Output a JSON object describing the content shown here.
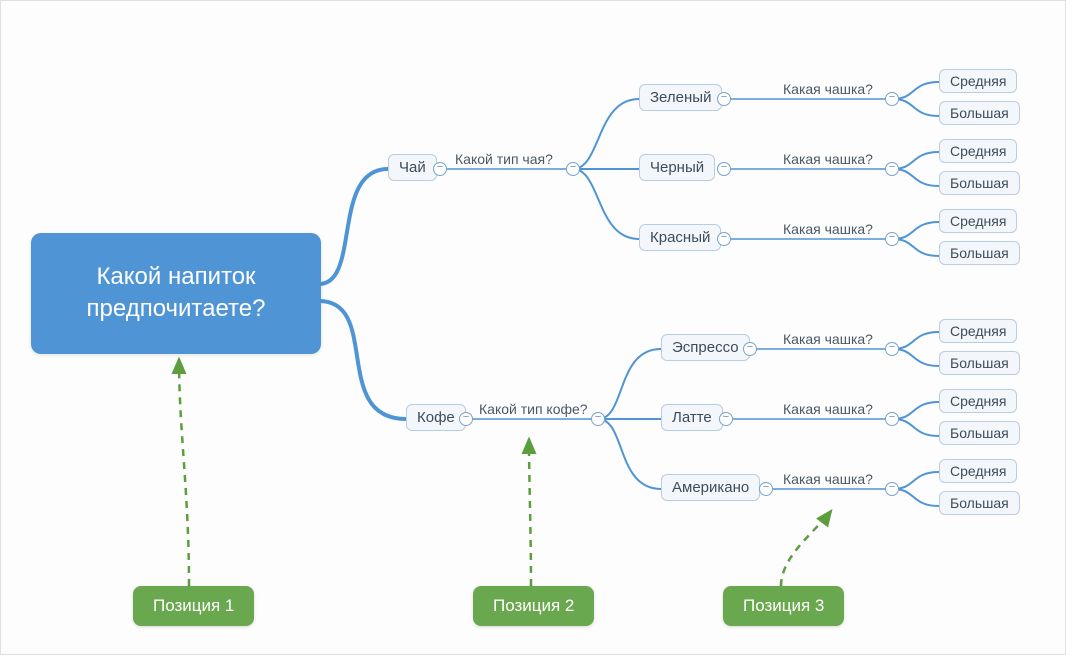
{
  "root": {
    "label": "Какой напиток предпочитаете?"
  },
  "level1": {
    "tea": {
      "label": "Чай",
      "question": "Какой тип чая?"
    },
    "coffee": {
      "label": "Кофе",
      "question": "Какой тип кофе?"
    }
  },
  "level2": {
    "green": {
      "label": "Зеленый",
      "question": "Какая чашка?"
    },
    "black": {
      "label": "Черный",
      "question": "Какая чашка?"
    },
    "red": {
      "label": "Красный",
      "question": "Какая чашка?"
    },
    "espresso": {
      "label": "Эспрессо",
      "question": "Какая чашка?"
    },
    "latte": {
      "label": "Латте",
      "question": "Какая чашка?"
    },
    "americano": {
      "label": "Американо",
      "question": "Какая чашка?"
    }
  },
  "leaves": {
    "medium": "Средняя",
    "large": "Большая"
  },
  "positions": {
    "p1": "Позиция 1",
    "p2": "Позиция 2",
    "p3": "Позиция 3"
  },
  "colors": {
    "accent_blue": "#4f94d4",
    "node_border": "#b9cde0",
    "node_bg": "#f3f7fb",
    "badge_green": "#6aa84f",
    "wire": "#4f94d4",
    "dashed": "#5c9e3d"
  }
}
